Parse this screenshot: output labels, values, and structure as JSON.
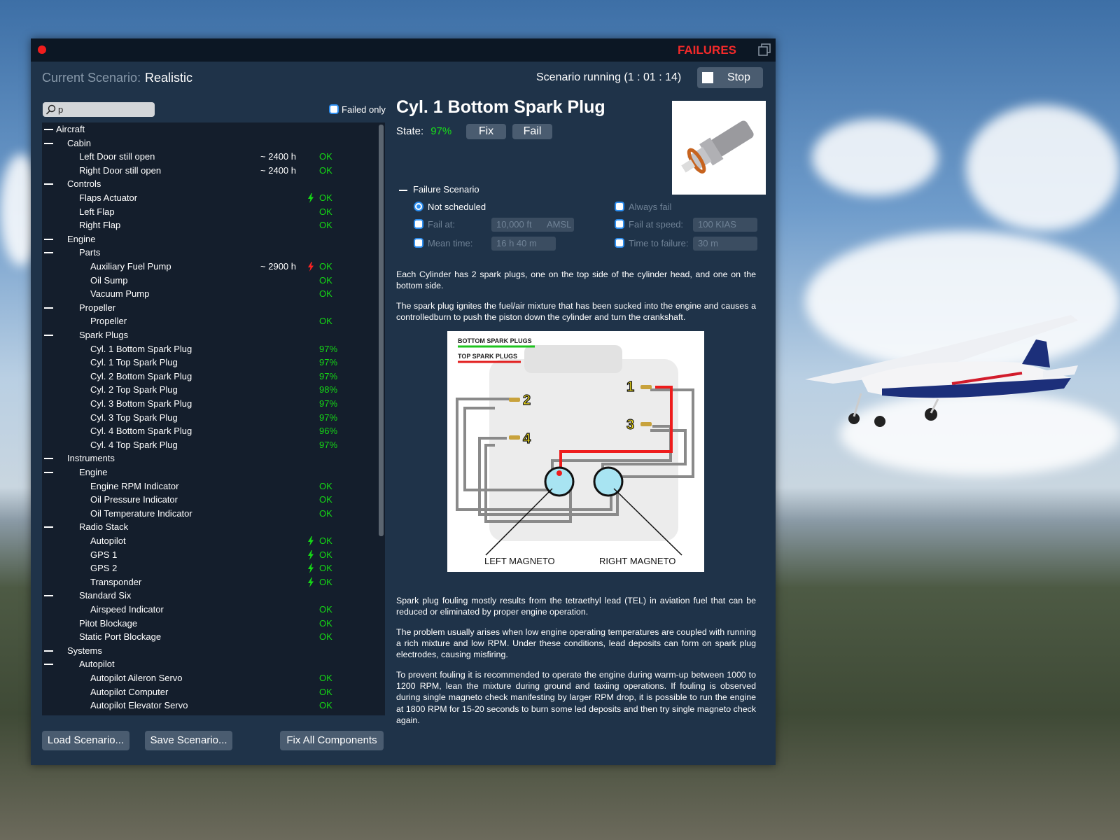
{
  "window": {
    "title": "FAILURES",
    "close_color": "#f01d1d"
  },
  "header": {
    "scenario_label": "Current Scenario:",
    "scenario_value": "Realistic",
    "running": "Scenario running (1 : 01 : 14)",
    "stop_label": "Stop"
  },
  "search": {
    "value": "p",
    "failed_only_label": "Failed only",
    "failed_only_checked": false
  },
  "tree": [
    {
      "level": 0,
      "label": "Aircraft",
      "group": true
    },
    {
      "level": 1,
      "label": "Cabin",
      "group": true
    },
    {
      "level": 2,
      "label": "Left Door still open",
      "hours": "~ 2400 h",
      "status": "OK"
    },
    {
      "level": 2,
      "label": "Right Door still open",
      "hours": "~ 2400 h",
      "status": "OK"
    },
    {
      "level": 1,
      "label": "Controls",
      "group": true
    },
    {
      "level": 2,
      "label": "Flaps Actuator",
      "icon": "bolt-green-icon",
      "status": "OK"
    },
    {
      "level": 2,
      "label": "Left Flap",
      "status": "OK"
    },
    {
      "level": 2,
      "label": "Right Flap",
      "status": "OK"
    },
    {
      "level": 1,
      "label": "Engine",
      "group": true
    },
    {
      "level": 2,
      "label": "Parts",
      "group": true
    },
    {
      "level": 3,
      "label": "Auxiliary Fuel Pump",
      "hours": "~ 2900 h",
      "icon": "bolt-red-icon",
      "status": "OK"
    },
    {
      "level": 3,
      "label": "Oil Sump",
      "status": "OK"
    },
    {
      "level": 3,
      "label": "Vacuum Pump",
      "status": "OK"
    },
    {
      "level": 2,
      "label": "Propeller",
      "group": true
    },
    {
      "level": 3,
      "label": "Propeller",
      "status": "OK"
    },
    {
      "level": 2,
      "label": "Spark Plugs",
      "group": true
    },
    {
      "level": 3,
      "label": "Cyl. 1 Bottom Spark Plug",
      "status": "97%"
    },
    {
      "level": 3,
      "label": "Cyl. 1 Top Spark Plug",
      "status": "97%"
    },
    {
      "level": 3,
      "label": "Cyl. 2 Bottom Spark Plug",
      "status": "97%"
    },
    {
      "level": 3,
      "label": "Cyl. 2 Top Spark Plug",
      "status": "98%"
    },
    {
      "level": 3,
      "label": "Cyl. 3 Bottom Spark Plug",
      "status": "97%"
    },
    {
      "level": 3,
      "label": "Cyl. 3 Top Spark Plug",
      "status": "97%"
    },
    {
      "level": 3,
      "label": "Cyl. 4 Bottom Spark Plug",
      "status": "96%"
    },
    {
      "level": 3,
      "label": "Cyl. 4 Top Spark Plug",
      "status": "97%"
    },
    {
      "level": 1,
      "label": "Instruments",
      "group": true
    },
    {
      "level": 2,
      "label": "Engine",
      "group": true
    },
    {
      "level": 3,
      "label": "Engine RPM Indicator",
      "status": "OK"
    },
    {
      "level": 3,
      "label": "Oil Pressure Indicator",
      "status": "OK"
    },
    {
      "level": 3,
      "label": "Oil Temperature Indicator",
      "status": "OK"
    },
    {
      "level": 2,
      "label": "Radio Stack",
      "group": true
    },
    {
      "level": 3,
      "label": "Autopilot",
      "icon": "bolt-green-icon",
      "status": "OK"
    },
    {
      "level": 3,
      "label": "GPS 1",
      "icon": "bolt-green-icon",
      "status": "OK"
    },
    {
      "level": 3,
      "label": "GPS 2",
      "icon": "bolt-green-icon",
      "status": "OK"
    },
    {
      "level": 3,
      "label": "Transponder",
      "icon": "bolt-green-icon",
      "status": "OK"
    },
    {
      "level": 2,
      "label": "Standard Six",
      "group": true
    },
    {
      "level": 3,
      "label": "Airspeed Indicator",
      "status": "OK"
    },
    {
      "level": 2,
      "label": "Pitot Blockage",
      "status": "OK"
    },
    {
      "level": 2,
      "label": "Static Port Blockage",
      "status": "OK"
    },
    {
      "level": 1,
      "label": "Systems",
      "group": true
    },
    {
      "level": 2,
      "label": "Autopilot",
      "group": true
    },
    {
      "level": 3,
      "label": "Autopilot Aileron Servo",
      "status": "OK"
    },
    {
      "level": 3,
      "label": "Autopilot Computer",
      "status": "OK"
    },
    {
      "level": 3,
      "label": "Autopilot Elevator Servo",
      "status": "OK"
    }
  ],
  "footer": {
    "load": "Load Scenario...",
    "save": "Save Scenario...",
    "fix_all": "Fix All Components"
  },
  "detail": {
    "title": "Cyl. 1 Bottom Spark Plug",
    "state_label": "State:",
    "state_value": "97%",
    "fix": "Fix",
    "fail": "Fail",
    "failure_scenario": "Failure Scenario",
    "options": {
      "not_scheduled": "Not scheduled",
      "always_fail": "Always fail",
      "fail_at": "Fail at:",
      "fail_at_value": "10,000 ft",
      "fail_at_ref": "AMSL",
      "fail_at_speed": "Fail at speed:",
      "fail_at_speed_value": "100 KIAS",
      "mean_time": "Mean time:",
      "mean_time_value": "16 h 40 m",
      "time_to_failure": "Time to failure:",
      "time_to_failure_value": "30 m",
      "selected": "not_scheduled"
    },
    "paragraphs1": [
      "Each Cylinder has 2 spark plugs, one on the top side of the cylinder head, and one on the bottom side.",
      "The spark plug ignites the fuel/air mixture that has been sucked into the engine and causes a controlledburn to push the piston down the cylinder and turn the crankshaft."
    ],
    "diagram": {
      "bottom_legend": "BOTTOM SPARK PLUGS",
      "top_legend": "TOP SPARK PLUGS",
      "left_magneto": "LEFT MAGNETO",
      "right_magneto": "RIGHT MAGNETO",
      "n1": "1",
      "n2": "2",
      "n3": "3",
      "n4": "4"
    },
    "paragraphs2": [
      "Spark plug fouling mostly results from the tetraethyl lead (TEL) in aviation fuel that can be reduced or eliminated by proper engine operation.",
      "The problem usually arises when low engine operating temperatures are coupled with running a rich mixture and low RPM. Under these conditions, lead deposits can form on spark plug electrodes, causing misfiring.",
      "To prevent fouling it is recommended to operate the engine during warm-up between 1000 to 1200 RPM, lean the mixture during ground and taxiing operations. If fouling is observed during single magneto check manifesting by larger RPM drop, it is possible to run the engine at 1800 RPM for 15-20 seconds to burn some led deposits and then try single magneto check again."
    ]
  },
  "colors": {
    "ok": "#15d915",
    "title_red": "#f42a2a",
    "panel": "#1f3349",
    "tree_bg": "#141e2c"
  }
}
